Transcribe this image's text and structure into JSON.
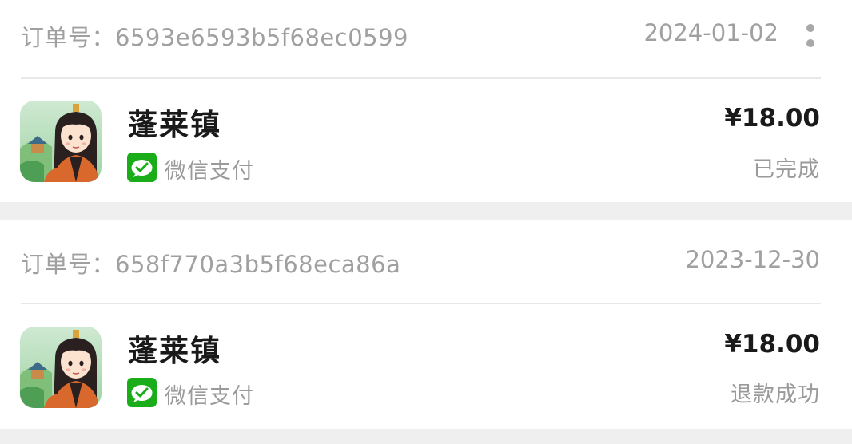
{
  "orders": [
    {
      "order_no_label": "订单号：6593e6593b5f68ec0599",
      "date": "2024-01-02",
      "app_name": "蓬莱镇",
      "pay_method": "微信支付",
      "price": "¥18.00",
      "status": "已完成",
      "more_icon": "more-vertical-icon"
    },
    {
      "order_no_label": "订单号：658f770a3b5f68eca86a",
      "date": "2023-12-30",
      "app_name": "蓬莱镇",
      "pay_method": "微信支付",
      "price": "¥18.00",
      "status": "退款成功"
    }
  ],
  "colors": {
    "background": "#efefef",
    "card": "#ffffff",
    "muted_text": "#a0a0a0",
    "primary_text": "#1a1a1a",
    "wechat_green": "#1aad19"
  },
  "icons": {
    "app_icon": "penglai-town-app-icon",
    "pay_icon": "wechat-pay-icon"
  }
}
